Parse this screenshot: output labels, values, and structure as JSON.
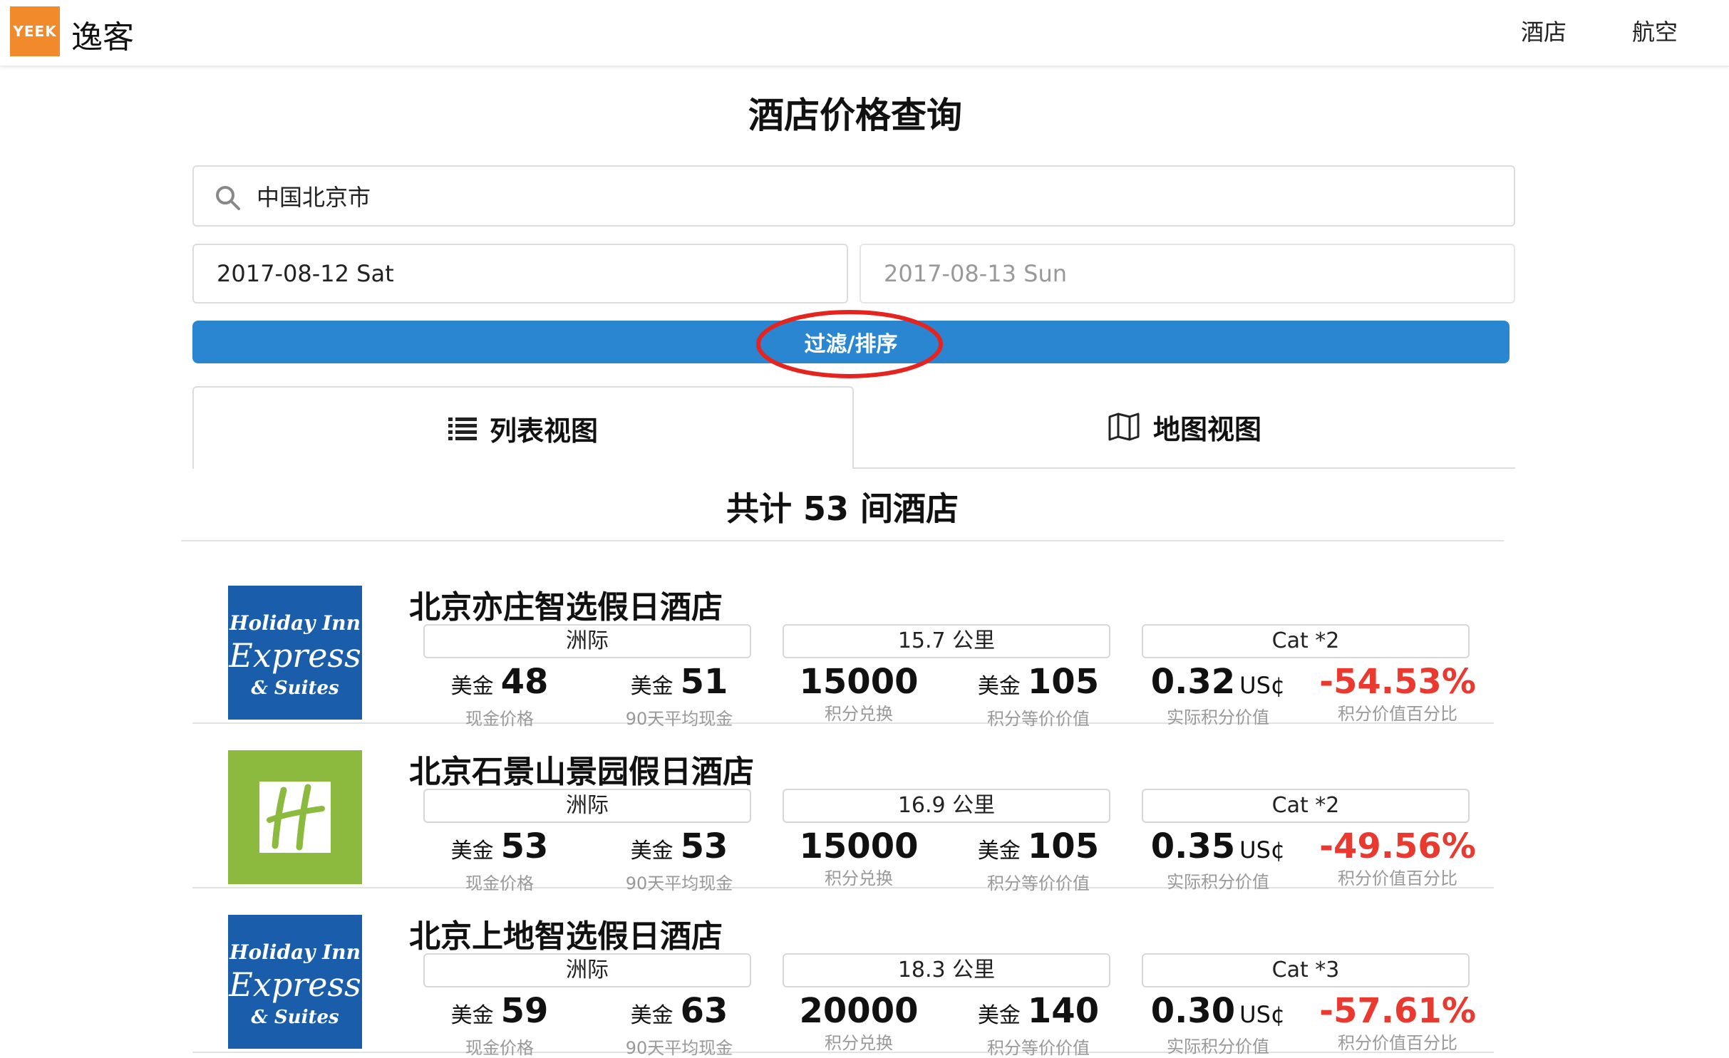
{
  "header": {
    "logo_text": "YEEK",
    "brand": "逸客",
    "nav": [
      {
        "label": "酒店"
      },
      {
        "label": "航空"
      }
    ]
  },
  "page_title": "酒店价格查询",
  "search": {
    "value": "中国北京市",
    "icon": "search-icon"
  },
  "dates": {
    "checkin": "2017-08-12 Sat",
    "checkout": "2017-08-13 Sun"
  },
  "filter_button": "过滤/排序",
  "highlight_color": "#e52420",
  "tabs": {
    "list": {
      "label": "列表视图",
      "icon": "list-icon"
    },
    "map": {
      "label": "地图视图",
      "icon": "map-icon"
    }
  },
  "result_count": "共计 53 间酒店",
  "labels": {
    "currency": "美金",
    "distance_unit": "公里",
    "cash_price": "现金价格",
    "avg_90d": "90天平均现金",
    "points_redeem": "积分兑换",
    "points_equiv": "积分等价价值",
    "actual_point_value": "实际积分价值",
    "point_value_pct": "积分价值百分比",
    "cent_unit": "US¢"
  },
  "colors": {
    "primary": "#2a86d1",
    "negative": "#ea3a30",
    "logo_orange": "#f08a2a",
    "hiex_blue": "#1a5eab",
    "hi_green": "#8cba3e"
  },
  "hotels": [
    {
      "name": "北京亦庄智选假日酒店",
      "logo": "holiday-inn-express",
      "logo_lines": [
        "Holiday Inn",
        "Express",
        "& Suites"
      ],
      "brand_group": "洲际",
      "distance": "15.7",
      "category": "Cat *2",
      "cash_price": "48",
      "avg_cash": "51",
      "points": "15000",
      "points_value": "105",
      "actual_value": "0.32",
      "value_pct": "-54.53%"
    },
    {
      "name": "北京石景山景园假日酒店",
      "logo": "holiday-inn",
      "brand_group": "洲际",
      "distance": "16.9",
      "category": "Cat *2",
      "cash_price": "53",
      "avg_cash": "53",
      "points": "15000",
      "points_value": "105",
      "actual_value": "0.35",
      "value_pct": "-49.56%"
    },
    {
      "name": "北京上地智选假日酒店",
      "logo": "holiday-inn-express",
      "logo_lines": [
        "Holiday Inn",
        "Express",
        "& Suites"
      ],
      "brand_group": "洲际",
      "distance": "18.3",
      "category": "Cat *3",
      "cash_price": "59",
      "avg_cash": "63",
      "points": "20000",
      "points_value": "140",
      "actual_value": "0.30",
      "value_pct": "-57.61%"
    }
  ]
}
